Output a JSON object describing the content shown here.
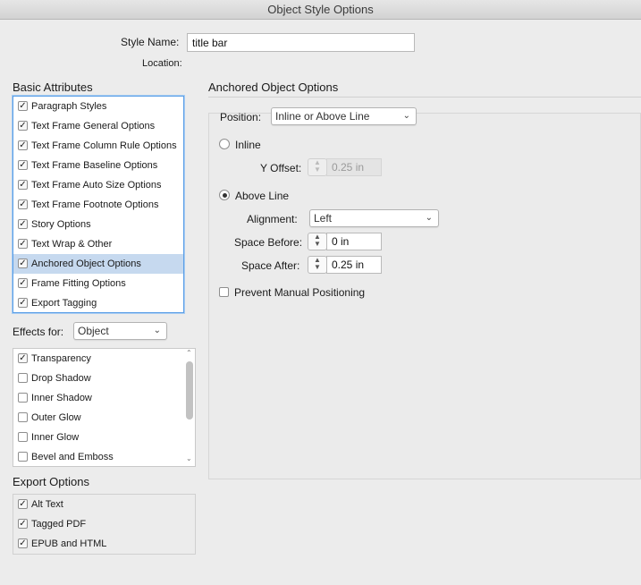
{
  "window": {
    "title": "Object Style Options"
  },
  "style_name": {
    "label": "Style Name:",
    "value": "title bar"
  },
  "location": {
    "label": "Location:"
  },
  "basic_attributes": {
    "heading": "Basic Attributes",
    "items": [
      {
        "label": "Paragraph Styles",
        "checked": true
      },
      {
        "label": "Text Frame General Options",
        "checked": true
      },
      {
        "label": "Text Frame Column Rule Options",
        "checked": true
      },
      {
        "label": "Text Frame Baseline Options",
        "checked": true
      },
      {
        "label": "Text Frame Auto Size Options",
        "checked": true
      },
      {
        "label": "Text Frame Footnote Options",
        "checked": true
      },
      {
        "label": "Story Options",
        "checked": true
      },
      {
        "label": "Text Wrap & Other",
        "checked": true
      },
      {
        "label": "Anchored Object Options",
        "checked": true,
        "selected": true
      },
      {
        "label": "Frame Fitting Options",
        "checked": true
      },
      {
        "label": "Export Tagging",
        "checked": true
      }
    ]
  },
  "effects_for": {
    "label": "Effects for:",
    "value": "Object",
    "items": [
      {
        "label": "Transparency",
        "checked": true
      },
      {
        "label": "Drop Shadow",
        "checked": false
      },
      {
        "label": "Inner Shadow",
        "checked": false
      },
      {
        "label": "Outer Glow",
        "checked": false
      },
      {
        "label": "Inner Glow",
        "checked": false
      },
      {
        "label": "Bevel and Emboss",
        "checked": false
      }
    ]
  },
  "export_options": {
    "heading": "Export Options",
    "items": [
      {
        "label": "Alt Text",
        "checked": true
      },
      {
        "label": "Tagged PDF",
        "checked": true
      },
      {
        "label": "EPUB and HTML",
        "checked": true
      }
    ]
  },
  "anchored": {
    "heading": "Anchored Object Options",
    "position_label": "Position:",
    "position_value": "Inline or Above Line",
    "inline_label": "Inline",
    "y_offset_label": "Y Offset:",
    "y_offset_value": "0.25 in",
    "above_line_label": "Above Line",
    "alignment_label": "Alignment:",
    "alignment_value": "Left",
    "space_before_label": "Space Before:",
    "space_before_value": "0 in",
    "space_after_label": "Space After:",
    "space_after_value": "0.25 in",
    "prevent_label": "Prevent Manual Positioning"
  },
  "colors": {
    "selection": "#c6d9ef",
    "focus_ring": "#5a9ee6"
  }
}
